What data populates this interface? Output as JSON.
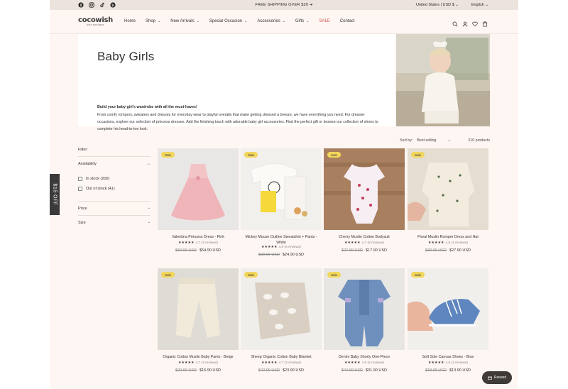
{
  "announcement": {
    "text": "FREE SHIPPING OVER $20  ➔",
    "currency": "United States | USD $  ⌄",
    "language": "English  ⌄",
    "social": [
      "facebook-icon",
      "instagram-icon",
      "tiktok-icon",
      "pinterest-icon"
    ]
  },
  "header": {
    "brand": "cocowish",
    "tagline": "kids boutique",
    "nav": [
      {
        "label": "Home",
        "dropdown": false
      },
      {
        "label": "Shop",
        "dropdown": true
      },
      {
        "label": "New Arrivals",
        "dropdown": true
      },
      {
        "label": "Special Occasion",
        "dropdown": true
      },
      {
        "label": "Accessories",
        "dropdown": true
      },
      {
        "label": "Gifts",
        "dropdown": true
      },
      {
        "label": "SALE",
        "dropdown": false
      },
      {
        "label": "Contact",
        "dropdown": false
      }
    ],
    "icons": [
      "search-icon",
      "account-icon",
      "wishlist-icon",
      "cart-icon"
    ]
  },
  "hero": {
    "title": "Baby Girls",
    "lead": "Build your baby girl's wardrobe with all the must-haves!",
    "description": "From comfy rompers, sweaters and dresses for everyday wear to playful overalls that make getting dressed a breeze, we have everything you need. For dressier occasions, explore our selection of princess dresses. Add the finishing touch with adorable baby girl accessories. Find the perfect gift or browse our collection of shoes to complete his head-to-toe look."
  },
  "toolbar": {
    "sort_label": "Sort by:",
    "sort_value": "Best selling",
    "count": "210 products"
  },
  "filter": {
    "title": "Filter:",
    "availability": "Availability",
    "in_stock": "In stock (200)",
    "out_of_stock": "Out of stock (41)",
    "price": "Price",
    "size": "Size"
  },
  "side_tab": "$15 OFF",
  "reward": "Reward",
  "products": [
    {
      "name": "Valentina Princess Dress - Pink",
      "rating": "4.7 (3 reviews)",
      "old": "$69.99 USD",
      "new": "$54.90 USD",
      "badge": "Sale",
      "stars": 4.7
    },
    {
      "name": "Mickey Mouse Outline Sweatshirt + Pants - White",
      "rating": "4.6 (5 reviews)",
      "old": "$39.99 USD",
      "new": "$24.90 USD",
      "badge": "Sale",
      "stars": 4.6
    },
    {
      "name": "Cherry Muslin Cotton Bodysuit",
      "rating": "4.7 (9 reviews)",
      "old": "$27.99 USD",
      "new": "$17.90 USD",
      "badge": "Sale",
      "stars": 4.7
    },
    {
      "name": "Floral Muslin Romper Dress and Hat",
      "rating": "4.6 (4 reviews)",
      "old": "$39.99 USD",
      "new": "$27.90 USD",
      "badge": "Sale",
      "stars": 4.6
    },
    {
      "name": "Organic Cotton Muslin Baby Pants - Beige",
      "rating": "4.7 (3 reviews)",
      "old": "$29.90 USD",
      "new": "$16.90 USD",
      "badge": "Sale",
      "stars": 4.7
    },
    {
      "name": "Sheep Organic Cotton Baby Blanket",
      "rating": "4.7 (3 reviews)",
      "old": "$42.99 USD",
      "new": "$23.90 USD",
      "badge": "Sale",
      "stars": 4.7
    },
    {
      "name": "Denim Baby Shorty One-Piece",
      "rating": "4.6 (5 reviews)",
      "old": "$44.90 USD",
      "new": "$31.90 USD",
      "badge": "Sale",
      "stars": 4.6
    },
    {
      "name": "Soft Sole Canvas Shoes - Blue",
      "rating": "4.5 (2 reviews)",
      "old": "$18.99 USD",
      "new": "$13.90 USD",
      "badge": "Sale",
      "stars": 4.5
    }
  ]
}
